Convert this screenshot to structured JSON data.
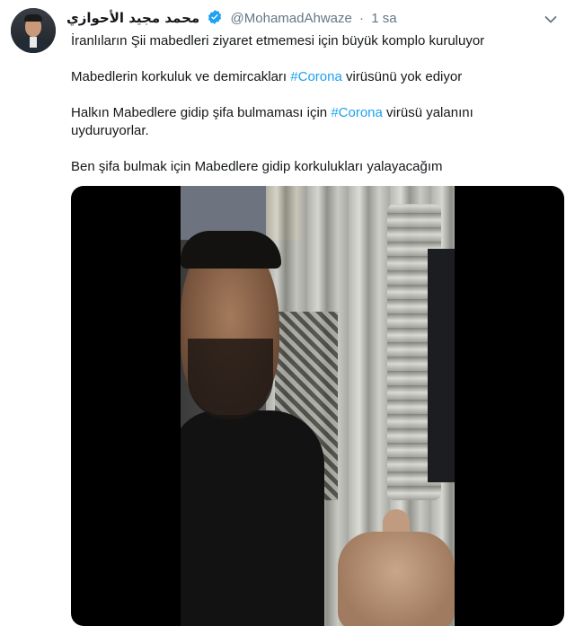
{
  "tweet": {
    "author_name": "محمد مجيد الأحوازي",
    "handle": "@MohamadAhwaze",
    "separator": "·",
    "time": "1 sa",
    "lines": {
      "l1": "İranlıların Şii mabedleri ziyaret etmemesi için büyük komplo kuruluyor",
      "l2a": "Mabedlerin korkuluk ve demircakları ",
      "l2tag": "#Corona",
      "l2b": " virüsünü yok ediyor",
      "l3a": "Halkın Mabedlere gidip şifa bulmaması için ",
      "l3tag": "#Corona",
      "l3b": " virüsü yalanını uyduruyorlar.",
      "l4": "Ben şifa bulmak için Mabedlere gidip korkulukları yalayacağım"
    },
    "colors": {
      "hashtag": "#1da1f2",
      "verified": "#1da1f2",
      "muted": "#657786"
    },
    "icons": {
      "verified": "verified-badge-icon",
      "more": "chevron-down-icon"
    }
  }
}
